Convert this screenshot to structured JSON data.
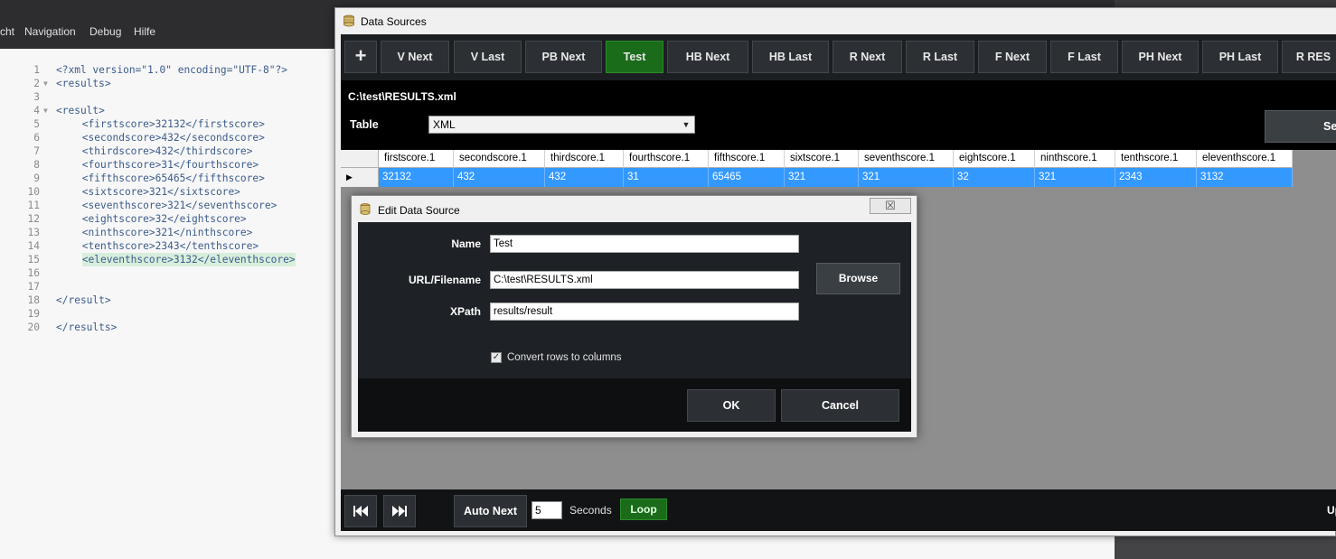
{
  "editor": {
    "menu": [
      "cht",
      "Navigation",
      "Debug",
      "Hilfe"
    ],
    "lines": [
      {
        "num": "1",
        "fold": "",
        "text": "<?xml version=\"1.0\" encoding=\"UTF-8\"?>",
        "indent": ""
      },
      {
        "num": "2",
        "fold": "▼",
        "text": "<results>",
        "indent": ""
      },
      {
        "num": "3",
        "fold": "",
        "text": "",
        "indent": ""
      },
      {
        "num": "4",
        "fold": "▼",
        "text": "<result>",
        "indent": ""
      },
      {
        "num": "5",
        "fold": "",
        "text": "<firstscore>32132</firstscore>",
        "indent": "    "
      },
      {
        "num": "6",
        "fold": "",
        "text": "<secondscore>432</secondscore>",
        "indent": "    "
      },
      {
        "num": "7",
        "fold": "",
        "text": "<thirdscore>432</thirdscore>",
        "indent": "    "
      },
      {
        "num": "8",
        "fold": "",
        "text": "<fourthscore>31</fourthscore>",
        "indent": "    "
      },
      {
        "num": "9",
        "fold": "",
        "text": "<fifthscore>65465</fifthscore>",
        "indent": "    "
      },
      {
        "num": "10",
        "fold": "",
        "text": "<sixtscore>321</sixtscore>",
        "indent": "    "
      },
      {
        "num": "11",
        "fold": "",
        "text": "<seventhscore>321</seventhscore>",
        "indent": "    "
      },
      {
        "num": "12",
        "fold": "",
        "text": "<eightscore>32</eightscore>",
        "indent": "    "
      },
      {
        "num": "13",
        "fold": "",
        "text": "<ninthscore>321</ninthscore>",
        "indent": "    "
      },
      {
        "num": "14",
        "fold": "",
        "text": "<tenthscore>2343</tenthscore>",
        "indent": "    "
      },
      {
        "num": "15",
        "fold": "",
        "text": "<eleventhscore>3132</eleventhscore>",
        "indent": "    "
      },
      {
        "num": "16",
        "fold": "",
        "text": "",
        "indent": ""
      },
      {
        "num": "17",
        "fold": "",
        "text": "",
        "indent": ""
      },
      {
        "num": "18",
        "fold": "",
        "text": "</result>",
        "indent": ""
      },
      {
        "num": "19",
        "fold": "",
        "text": "",
        "indent": ""
      },
      {
        "num": "20",
        "fold": "",
        "text": "</results>",
        "indent": ""
      }
    ],
    "highlight_line": "15"
  },
  "main_window": {
    "title": "Data Sources",
    "add_label": "+",
    "toolbar_buttons": [
      "V Next",
      "V Last",
      "PB Next",
      "Test",
      "HB Next",
      "HB Last",
      "R Next",
      "R Last",
      "F Next",
      "F Last",
      "PH Next",
      "PH Last",
      "R RES"
    ],
    "active_button": "Test",
    "path": "C:\\test\\RESULTS.xml",
    "table_label": "Table",
    "table_value": "XML",
    "side_button_label": "Se",
    "grid": {
      "columns": [
        "firstscore.1",
        "secondscore.1",
        "thirdscore.1",
        "fourthscore.1",
        "fifthscore.1",
        "sixtscore.1",
        "seventhscore.1",
        "eightscore.1",
        "ninthscore.1",
        "tenthscore.1",
        "eleventhscore.1"
      ],
      "rows": [
        [
          "32132",
          "432",
          "432",
          "31",
          "65465",
          "321",
          "321",
          "32",
          "321",
          "2343",
          "3132"
        ]
      ]
    },
    "bottom": {
      "first_icon": "skip-back-icon",
      "last_icon": "skip-forward-icon",
      "auto_next_label": "Auto Next",
      "seconds_value": "5",
      "seconds_label": "Seconds",
      "loop_label": "Loop",
      "up_label": "Up"
    }
  },
  "dialog": {
    "title": "Edit Data Source",
    "close_glyph": "☒",
    "name_label": "Name",
    "name_value": "Test",
    "url_label": "URL/Filename",
    "url_value": "C:\\test\\RESULTS.xml",
    "browse_label": "Browse",
    "xpath_label": "XPath",
    "xpath_value": "results/result",
    "convert_label": "Convert rows to columns",
    "convert_checked": true,
    "ok_label": "OK",
    "cancel_label": "Cancel"
  },
  "colors": {
    "accent_green": "#1a6b1a",
    "selection_blue": "#3399ff"
  }
}
